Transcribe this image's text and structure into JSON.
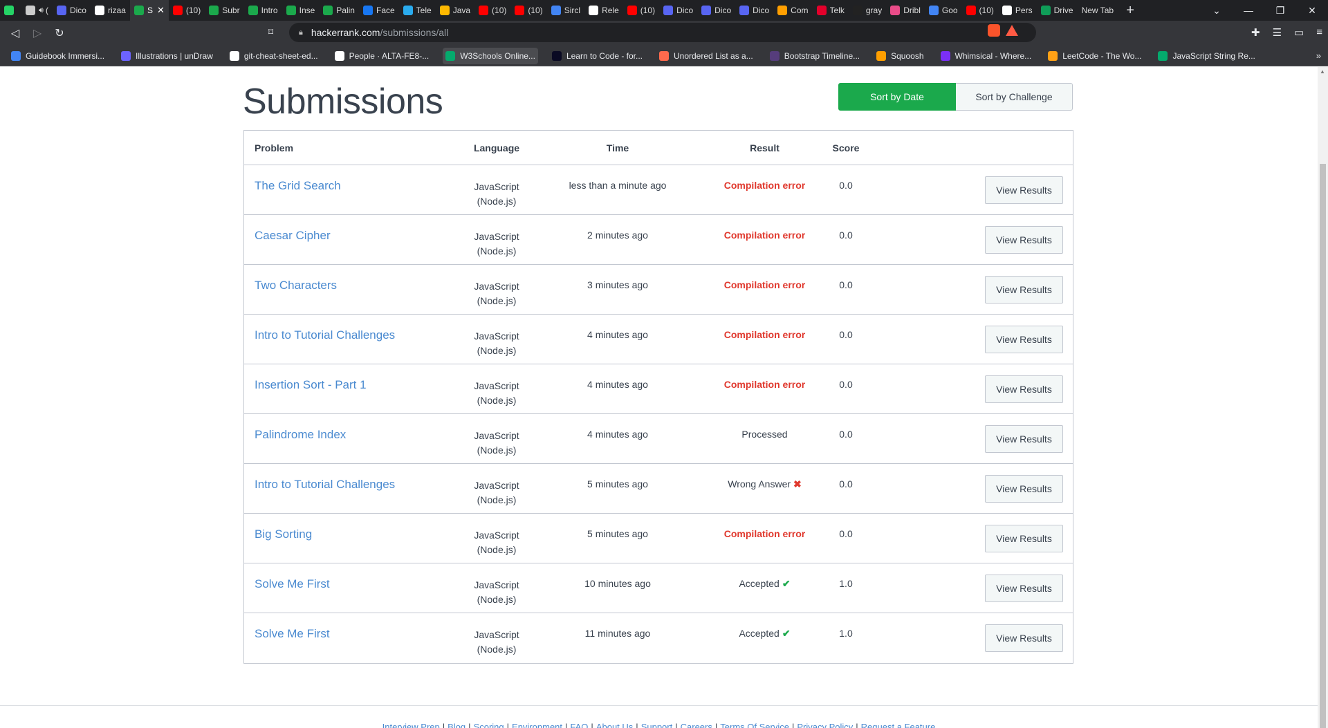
{
  "browser": {
    "tabs": [
      {
        "label": "",
        "color": "#25d366",
        "active": false,
        "sound": false
      },
      {
        "label": "(",
        "color": "#cccccc",
        "active": false,
        "sound": true
      },
      {
        "label": "Dico",
        "color": "#5865f2",
        "active": false,
        "sound": false
      },
      {
        "label": "rizaa",
        "color": "#ffffff",
        "active": false,
        "sound": false
      },
      {
        "label": "S",
        "color": "#1ba94c",
        "active": true,
        "sound": false
      },
      {
        "label": "(10)",
        "color": "#ff0000",
        "active": false,
        "sound": false
      },
      {
        "label": "Subr",
        "color": "#1ba94c",
        "active": false,
        "sound": false
      },
      {
        "label": "Intro",
        "color": "#1ba94c",
        "active": false,
        "sound": false
      },
      {
        "label": "Inse",
        "color": "#1ba94c",
        "active": false,
        "sound": false
      },
      {
        "label": "Palin",
        "color": "#1ba94c",
        "active": false,
        "sound": false
      },
      {
        "label": "Face",
        "color": "#1877f2",
        "active": false,
        "sound": false
      },
      {
        "label": "Tele",
        "color": "#2aabee",
        "active": false,
        "sound": false
      },
      {
        "label": "Java",
        "color": "#ffb900",
        "active": false,
        "sound": false
      },
      {
        "label": "(10)",
        "color": "#ff0000",
        "active": false,
        "sound": false
      },
      {
        "label": "(10)",
        "color": "#ff0000",
        "active": false,
        "sound": false
      },
      {
        "label": "Sircl",
        "color": "#4285f4",
        "active": false,
        "sound": false
      },
      {
        "label": "Rele",
        "color": "#ffffff",
        "active": false,
        "sound": false
      },
      {
        "label": "(10)",
        "color": "#ff0000",
        "active": false,
        "sound": false
      },
      {
        "label": "Dico",
        "color": "#5865f2",
        "active": false,
        "sound": false
      },
      {
        "label": "Dico",
        "color": "#5865f2",
        "active": false,
        "sound": false
      },
      {
        "label": "Dico",
        "color": "#5865f2",
        "active": false,
        "sound": false
      },
      {
        "label": "Com",
        "color": "#ff9f00",
        "active": false,
        "sound": false
      },
      {
        "label": "Telk",
        "color": "#e4002b",
        "active": false,
        "sound": false
      },
      {
        "label": "gray",
        "color": "#222222",
        "active": false,
        "sound": false
      },
      {
        "label": "Dribl",
        "color": "#ea4c89",
        "active": false,
        "sound": false
      },
      {
        "label": "Goo",
        "color": "#4285f4",
        "active": false,
        "sound": false
      },
      {
        "label": "(10)",
        "color": "#ff0000",
        "active": false,
        "sound": false
      },
      {
        "label": "Pers",
        "color": "#ffffff",
        "active": false,
        "sound": false
      },
      {
        "label": "Drive",
        "color": "#0f9d58",
        "active": false,
        "sound": false
      },
      {
        "label": "New Tab",
        "color": "",
        "active": false,
        "sound": false
      }
    ],
    "url_host": "hackerrank.com",
    "url_path": "/submissions/all",
    "bookmarks": [
      {
        "label": "Guidebook Immersi...",
        "color": "#4285f4"
      },
      {
        "label": "Illustrations | unDraw",
        "color": "#6c63ff"
      },
      {
        "label": "git-cheat-sheet-ed...",
        "color": "#ffffff"
      },
      {
        "label": "People · ALTA-FE8-...",
        "color": "#ffffff"
      },
      {
        "label": "W3Schools Online...",
        "color": "#04aa6d"
      },
      {
        "label": "Learn to Code - for...",
        "color": "#0a0a23"
      },
      {
        "label": "Unordered List as a...",
        "color": "#ff6a4d"
      },
      {
        "label": "Bootstrap Timeline...",
        "color": "#563d7c"
      },
      {
        "label": "Squoosh",
        "color": "#ff9f00"
      },
      {
        "label": "Whimsical - Where...",
        "color": "#7b2ff7"
      },
      {
        "label": "LeetCode - The Wo...",
        "color": "#ffa116"
      },
      {
        "label": "JavaScript String Re...",
        "color": "#04aa6d"
      }
    ]
  },
  "page": {
    "title": "Submissions",
    "sort_by_date": "Sort by Date",
    "sort_by_challenge": "Sort by Challenge",
    "columns": {
      "problem": "Problem",
      "language": "Language",
      "time": "Time",
      "result": "Result",
      "score": "Score"
    },
    "view_results_label": "View Results",
    "rows": [
      {
        "problem": "The Grid Search",
        "language_line1": "JavaScript",
        "language_line2": "(Node.js)",
        "time": "less than a minute ago",
        "result": "Compilation error",
        "result_type": "error",
        "score": "0.0"
      },
      {
        "problem": "Caesar Cipher",
        "language_line1": "JavaScript",
        "language_line2": "(Node.js)",
        "time": "2 minutes ago",
        "result": "Compilation error",
        "result_type": "error",
        "score": "0.0"
      },
      {
        "problem": "Two Characters",
        "language_line1": "JavaScript",
        "language_line2": "(Node.js)",
        "time": "3 minutes ago",
        "result": "Compilation error",
        "result_type": "error",
        "score": "0.0"
      },
      {
        "problem": "Intro to Tutorial Challenges",
        "language_line1": "JavaScript",
        "language_line2": "(Node.js)",
        "time": "4 minutes ago",
        "result": "Compilation error",
        "result_type": "error",
        "score": "0.0"
      },
      {
        "problem": "Insertion Sort - Part 1",
        "language_line1": "JavaScript",
        "language_line2": "(Node.js)",
        "time": "4 minutes ago",
        "result": "Compilation error",
        "result_type": "error",
        "score": "0.0"
      },
      {
        "problem": "Palindrome Index",
        "language_line1": "JavaScript",
        "language_line2": "(Node.js)",
        "time": "4 minutes ago",
        "result": "Processed",
        "result_type": "neutral",
        "score": "0.0"
      },
      {
        "problem": "Intro to Tutorial Challenges",
        "language_line1": "JavaScript",
        "language_line2": "(Node.js)",
        "time": "5 minutes ago",
        "result": "Wrong Answer",
        "result_type": "wrong",
        "score": "0.0"
      },
      {
        "problem": "Big Sorting",
        "language_line1": "JavaScript",
        "language_line2": "(Node.js)",
        "time": "5 minutes ago",
        "result": "Compilation error",
        "result_type": "error",
        "score": "0.0"
      },
      {
        "problem": "Solve Me First",
        "language_line1": "JavaScript",
        "language_line2": "(Node.js)",
        "time": "10 minutes ago",
        "result": "Accepted",
        "result_type": "accepted",
        "score": "1.0"
      },
      {
        "problem": "Solve Me First",
        "language_line1": "JavaScript",
        "language_line2": "(Node.js)",
        "time": "11 minutes ago",
        "result": "Accepted",
        "result_type": "accepted",
        "score": "1.0"
      }
    ],
    "footer_links": [
      "Interview Prep",
      "Blog",
      "Scoring",
      "Environment",
      "FAQ",
      "About Us",
      "Support",
      "Careers",
      "Terms Of Service",
      "Privacy Policy",
      "Request a Feature"
    ]
  },
  "colors": {
    "accent_green": "#1ba94c",
    "link_blue": "#4a8ad0",
    "error_red": "#e0382d"
  }
}
